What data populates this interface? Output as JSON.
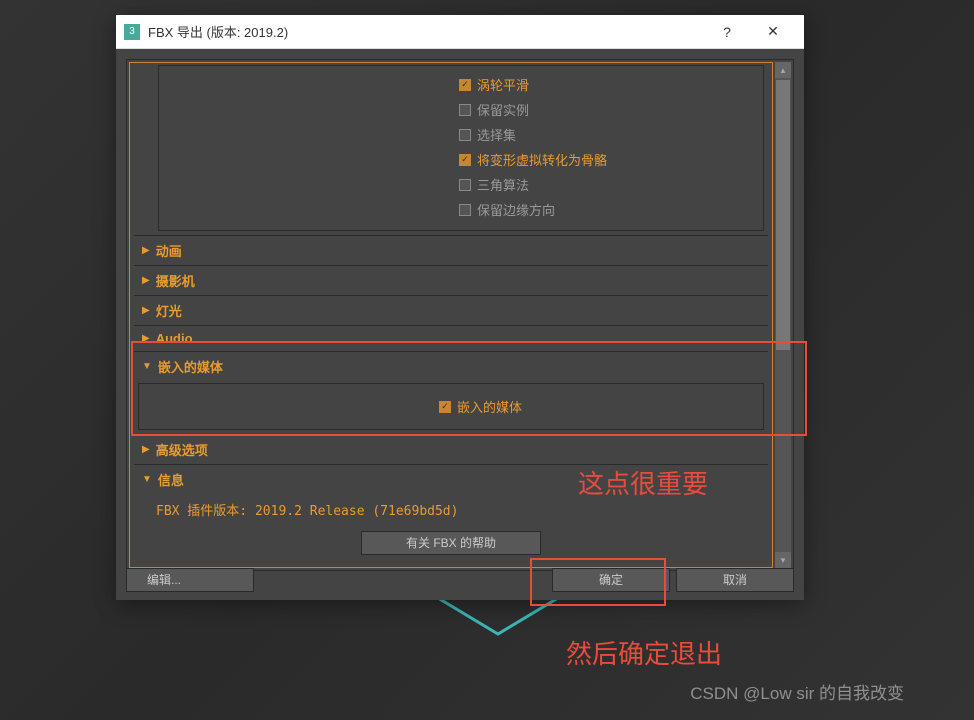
{
  "window": {
    "title": "FBX 导出 (版本: 2019.2)",
    "help": "?",
    "close": "✕",
    "icon": "3"
  },
  "options": {
    "turbo_smooth": "涡轮平滑",
    "keep_instances": "保留实例",
    "selection_sets": "选择集",
    "deform_to_bones": "将变形虚拟转化为骨骼",
    "triangulate": "三角算法",
    "preserve_edge": "保留边缘方向"
  },
  "sections": {
    "animation": "动画",
    "camera": "摄影机",
    "light": "灯光",
    "audio": "Audio",
    "embed_media": "嵌入的媒体",
    "advanced": "高级选项",
    "info": "信息"
  },
  "embed": {
    "label": "嵌入的媒体"
  },
  "info": {
    "version": "FBX 插件版本: 2019.2 Release (71e69bd5d)",
    "help_btn": "有关 FBX 的帮助"
  },
  "buttons": {
    "edit": "编辑...",
    "ok": "确定",
    "cancel": "取消"
  },
  "annotations": {
    "important": "这点很重要",
    "then_ok": "然后确定退出"
  },
  "watermark": "CSDN @Low sir   的自我改变"
}
